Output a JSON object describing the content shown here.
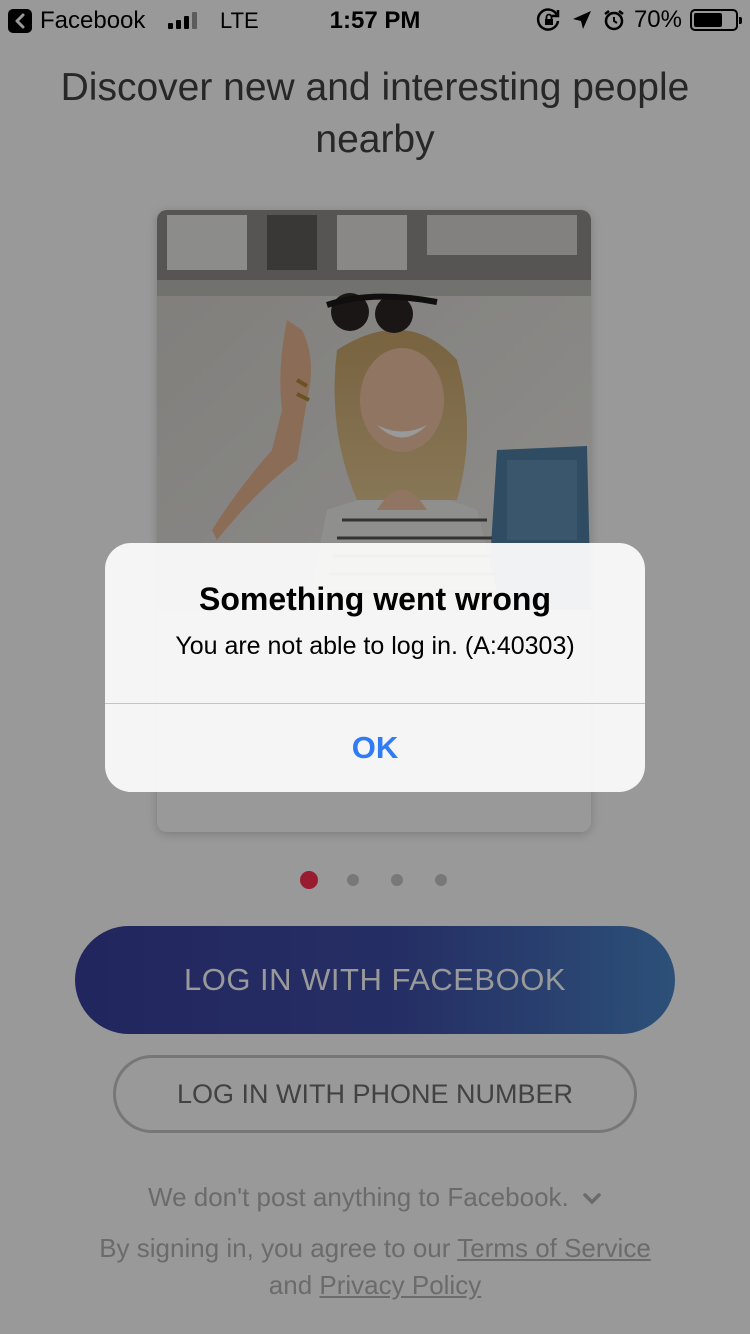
{
  "status_bar": {
    "back_app": "Facebook",
    "network": "LTE",
    "time": "1:57 PM",
    "battery_percent": "70%",
    "battery_level": 0.7,
    "icons": [
      "back-arrow-icon",
      "signal-icon",
      "rotation-lock-icon",
      "location-arrow-icon",
      "alarm-icon",
      "battery-icon"
    ]
  },
  "headline": "Discover new and interesting people nearby",
  "carousel": {
    "page_count": 4,
    "active_index": 0,
    "active_color": "#fd2d4f"
  },
  "buttons": {
    "facebook_login": "LOG IN WITH FACEBOOK",
    "phone_login": "LOG IN WITH PHONE NUMBER"
  },
  "note": "We don't post anything to Facebook.",
  "legal": {
    "prefix": "By signing in, you agree to our ",
    "terms": "Terms of Service",
    "connector": " and ",
    "privacy": "Privacy Policy"
  },
  "alert": {
    "title": "Something went wrong",
    "message": "You are not able to log in. (A:40303)",
    "ok_label": "OK",
    "ok_color": "#2f7cf6"
  },
  "colors": {
    "facebook_gradient_start": "#3a3f9e",
    "facebook_gradient_end": "#4a86c9"
  }
}
